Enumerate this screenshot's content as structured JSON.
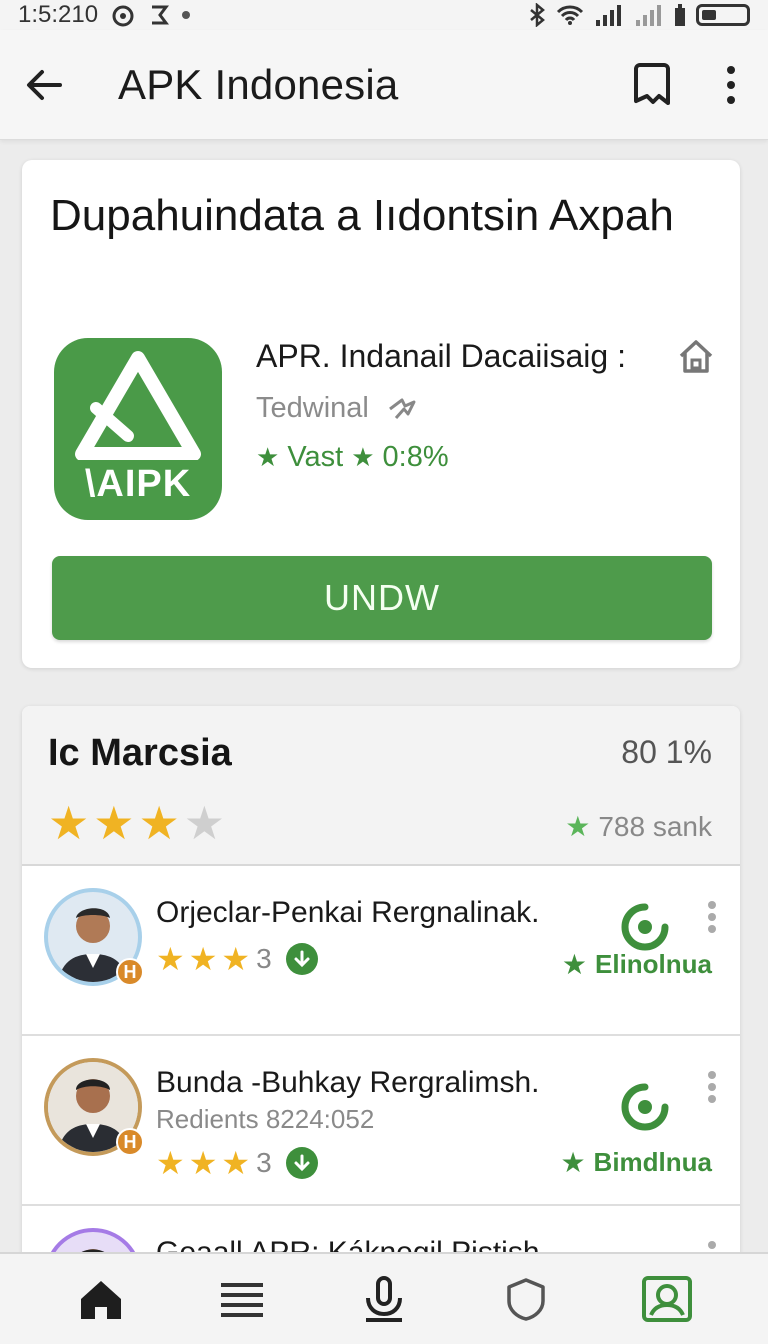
{
  "status_bar": {
    "time": "1:5:210",
    "icons": [
      "alarm-icon",
      "app-icon",
      "bluetooth-icon",
      "wifi-icon",
      "signal-icon",
      "signal-icon",
      "battery-icon"
    ]
  },
  "app_bar": {
    "title": "APK Indonesia",
    "icons": [
      "back-arrow-icon",
      "bookmark-icon",
      "more-vertical-icon"
    ]
  },
  "main_card": {
    "title": "Dupahuindata a Iıdontsin Axpah",
    "app_icon_text": "\\AIPK",
    "app_name": "APR. Indanail Dacaiisaig :",
    "developer": "Tedwinal",
    "rating_label": "Vast",
    "rating_value": "0:8%",
    "download_label": "UNDW",
    "accent": "#4e9b4b"
  },
  "reviews": {
    "title": "Ic Marcsia",
    "percent": "80 1%",
    "stars": 3,
    "count": "788 sank",
    "items": [
      {
        "name": "Orjeclar-Penkai Rergnalinak.",
        "stars_count": "3",
        "action_label": "Elinolnua",
        "badge": "H"
      },
      {
        "name": "Bunda -Buhkay Rergralimsh.",
        "sub": "Redients 8224:052",
        "stars_count": "3",
        "action_label": "Bimdlnua",
        "badge": "H"
      },
      {
        "name": "Geaall APR: Káknegil Pistish."
      }
    ]
  },
  "bottom_nav": {
    "items": [
      "home-icon",
      "menu-icon",
      "mic-icon",
      "shield-icon",
      "search-image-icon"
    ],
    "active": "search-image-icon"
  }
}
